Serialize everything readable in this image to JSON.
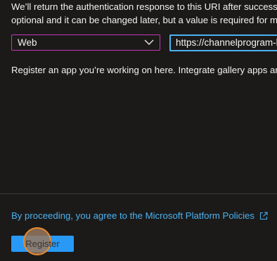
{
  "intro": {
    "line1": "We’ll return the authentication response to this URI after successful",
    "line2": "optional and it can be changed later, but a value is required for mo"
  },
  "platform_select": {
    "value": "Web"
  },
  "redirect_uri": {
    "value": "https://channelprogram-l"
  },
  "register_info": "Register an app you’re working on here. Integrate gallery apps and",
  "policy_link": "By proceeding, you agree to the Microsoft Platform Policies",
  "register_button": "Register",
  "colors": {
    "background": "#1b1a19",
    "link": "#4cb2f0",
    "primary_button": "#2899f5",
    "select_border": "#c239b3",
    "click_marker": "#e88b2e"
  }
}
